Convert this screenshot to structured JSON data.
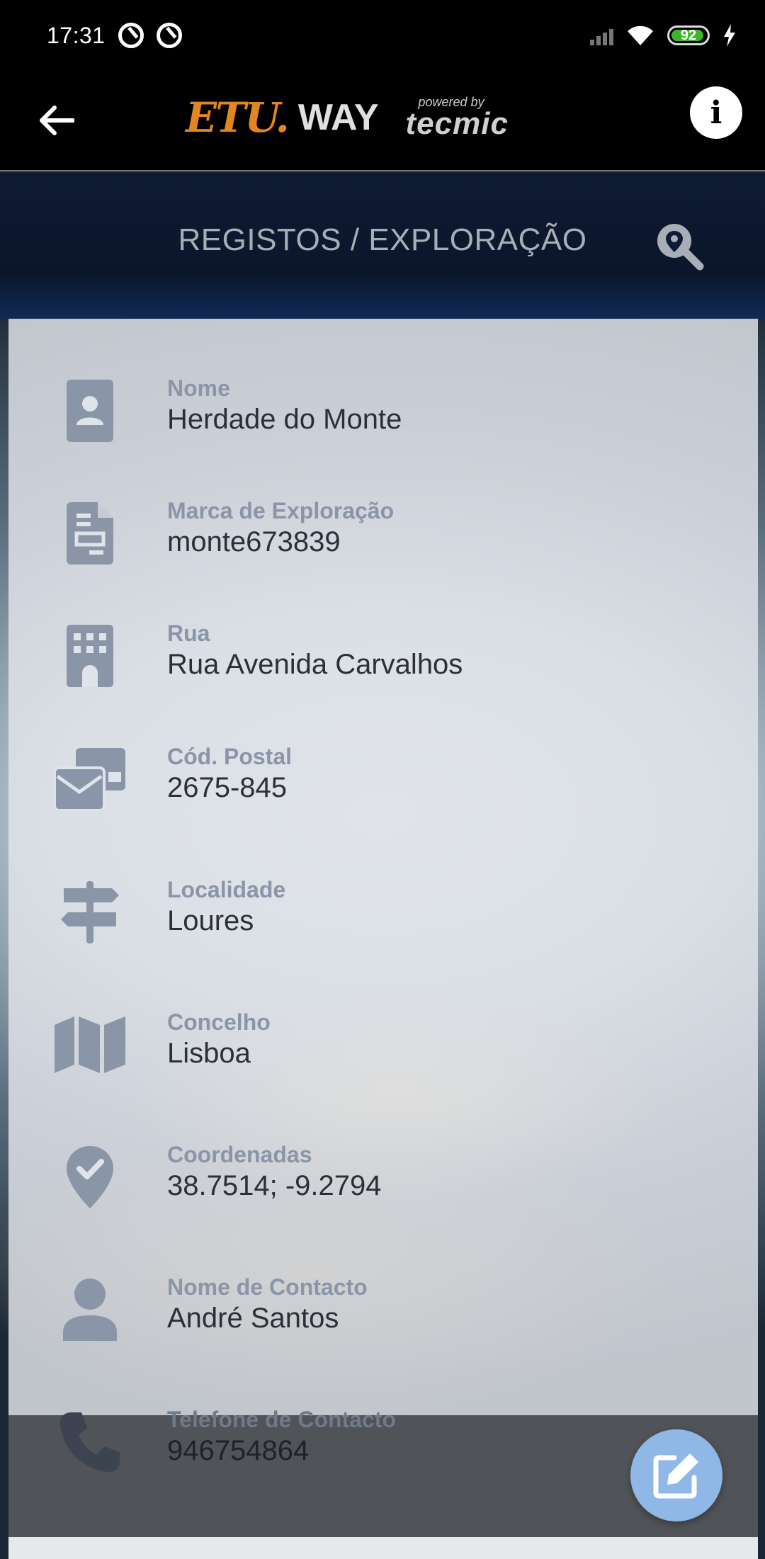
{
  "status_bar": {
    "time": "17:31",
    "battery": "92",
    "icons": [
      "do-not-disturb-icon",
      "sync-icon",
      "signal-icon",
      "wifi-icon",
      "battery-icon",
      "charging-icon"
    ]
  },
  "header": {
    "logo_part1": "ETU.",
    "logo_part2": "WAY",
    "powered_by": "powered by",
    "brand": "tecmic"
  },
  "page": {
    "title": "REGISTOS / EXPLORAÇÃO"
  },
  "fields": [
    {
      "label": "Nome",
      "value": "Herdade do Monte",
      "icon": "person-card-icon"
    },
    {
      "label": "Marca de Exploração",
      "value": "monte673839",
      "icon": "document-icon"
    },
    {
      "label": "Rua",
      "value": "Rua Avenida Carvalhos",
      "icon": "building-icon"
    },
    {
      "label": "Cód. Postal",
      "value": "2675-845",
      "icon": "mail-bulk-icon"
    },
    {
      "label": "Localidade",
      "value": "Loures",
      "icon": "signpost-icon"
    },
    {
      "label": "Concelho",
      "value": "Lisboa",
      "icon": "map-icon"
    },
    {
      "label": "Coordenadas",
      "value": "38.7514; -9.2794",
      "icon": "location-check-icon"
    },
    {
      "label": "Nome de Contacto",
      "value": "André Santos",
      "icon": "user-icon"
    },
    {
      "label": "Telefone de Contacto",
      "value": "946754864",
      "icon": "phone-icon"
    }
  ],
  "colors": {
    "icon": "#8a95a8",
    "label": "#8a95a8",
    "value": "#2c2f36",
    "fab": "#8fb8e6",
    "logo_orange": "#e2861f"
  }
}
